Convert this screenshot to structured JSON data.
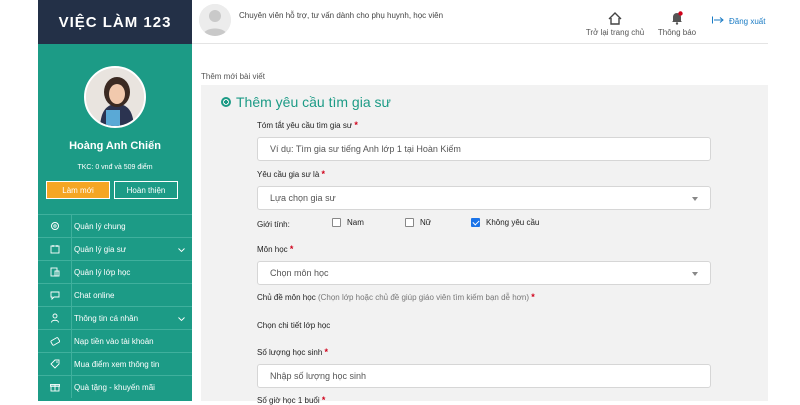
{
  "brand": {
    "name": "VIỆC LÀM 123"
  },
  "profile": {
    "name": "Hoàng Anh Chiến",
    "balance": "TKC: 0 vnđ và 509 điểm",
    "btn_new": "Làm mới",
    "btn_done": "Hoàn thiện"
  },
  "sidebar": {
    "items": [
      {
        "label": "Quản lý chung",
        "icon": "gear-icon",
        "chevron": false
      },
      {
        "label": "Quản lý gia sư",
        "icon": "tutor-manage-icon",
        "chevron": true
      },
      {
        "label": "Quản lý lớp học",
        "icon": "class-icon",
        "chevron": false
      },
      {
        "label": "Chat online",
        "icon": "chat-icon",
        "chevron": false
      },
      {
        "label": "Thông tin cá nhân",
        "icon": "user-icon",
        "chevron": true
      },
      {
        "label": "Nạp tiền vào tài khoản",
        "icon": "wallet-icon",
        "chevron": false
      },
      {
        "label": "Mua điểm xem thông tin",
        "icon": "tag-icon",
        "chevron": false
      },
      {
        "label": "Quà tặng - khuyến mãi",
        "icon": "gift-icon",
        "chevron": false
      }
    ]
  },
  "topbar": {
    "tagline": "Chuyên viên hỗ trợ, tư vấn dành cho phụ huynh, học viên",
    "home_label": "Trở lại trang chủ",
    "notify_label": "Thông báo",
    "logout_label": "Đăng xuất"
  },
  "breadcrumb": "Thêm mới bài viết",
  "form": {
    "title": "Thêm yêu cầu tìm gia sư",
    "summary_label": "Tóm tắt yêu cầu tìm gia sư",
    "summary_placeholder": "Ví dụ: Tìm gia sư tiếng Anh lớp 1 tại Hoàn Kiếm",
    "tutor_label": "Yêu cầu gia sư là",
    "tutor_value": "Lựa chọn gia sư",
    "gender_label": "Giới tính:",
    "gender_options": [
      {
        "label": "Nam",
        "checked": false
      },
      {
        "label": "Nữ",
        "checked": false
      },
      {
        "label": "Không yêu cầu",
        "checked": true
      }
    ],
    "subject_label": "Môn học",
    "subject_value": "Chọn môn học",
    "topic_label": "Chủ đề môn học",
    "topic_hint": "(Chọn lớp hoặc chủ đề giúp giáo viên tìm kiếm bạn dễ hơn)",
    "class_detail_label": "Chọn chi tiết lớp học",
    "students_label": "Số lượng học sinh",
    "students_placeholder": "Nhập số lượng học sinh",
    "next_label": "Số giờ học 1 buổi"
  },
  "colors": {
    "teal": "#1c9b86",
    "navy": "#233047",
    "orange": "#f5a623",
    "required": "#d0021b",
    "link": "#1a7bc4"
  }
}
